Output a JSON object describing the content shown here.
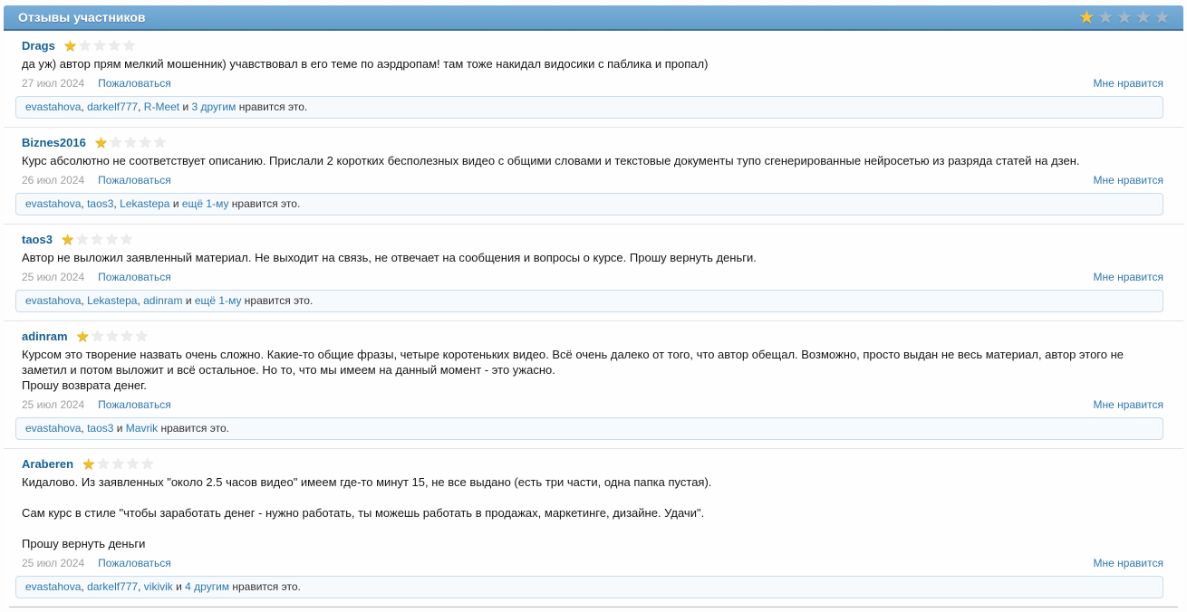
{
  "header": {
    "title": "Отзывы участников",
    "rating": 1,
    "max_rating": 5
  },
  "ui": {
    "report_label": "Пожаловаться",
    "like_label": "Мне нравится"
  },
  "colors": {
    "accent_bar": "#6aa3d0",
    "link": "#2e77ad",
    "username_link": "#176093",
    "star_gold": "#f1bf27",
    "star_empty": "#ececec",
    "like_box_bg": "#f6fafd",
    "like_box_border": "#c9dcea"
  },
  "reviews": [
    {
      "username": "Drags",
      "rating": 1,
      "date": "27 июл 2024",
      "paragraphs": [
        "да уж) автор прям мелкий мошенник) учавствовал в его теме по аэрдропам! там тоже накидал видосики с паблика и пропал)"
      ],
      "likes": [
        {
          "t": "evastahova",
          "link": true
        },
        {
          "t": ", ",
          "link": false
        },
        {
          "t": "darkelf777",
          "link": true
        },
        {
          "t": ", ",
          "link": false
        },
        {
          "t": "R-Meet",
          "link": true
        },
        {
          "t": " и ",
          "link": false
        },
        {
          "t": "3 другим",
          "link": true
        },
        {
          "t": " нравится это.",
          "link": false
        }
      ]
    },
    {
      "username": "Biznes2016",
      "rating": 1,
      "date": "26 июл 2024",
      "paragraphs": [
        "Курс абсолютно не соответствует описанию. Прислали 2 коротких бесполезных видео с общими словами и текстовые документы тупо сгенерированные нейросетью из разряда статей на дзен."
      ],
      "likes": [
        {
          "t": "evastahova",
          "link": true
        },
        {
          "t": ", ",
          "link": false
        },
        {
          "t": "taos3",
          "link": true
        },
        {
          "t": ", ",
          "link": false
        },
        {
          "t": "Lekastepa",
          "link": true
        },
        {
          "t": " и ",
          "link": false
        },
        {
          "t": "ещё 1-му",
          "link": true
        },
        {
          "t": " нравится это.",
          "link": false
        }
      ]
    },
    {
      "username": "taos3",
      "rating": 1,
      "date": "25 июл 2024",
      "paragraphs": [
        "Автор не выложил заявленный материал. Не выходит на связь, не отвечает на сообщения и вопросы о курсе. Прошу вернуть деньги."
      ],
      "likes": [
        {
          "t": "evastahova",
          "link": true
        },
        {
          "t": ", ",
          "link": false
        },
        {
          "t": "Lekastepa",
          "link": true
        },
        {
          "t": ", ",
          "link": false
        },
        {
          "t": "adinram",
          "link": true
        },
        {
          "t": " и ",
          "link": false
        },
        {
          "t": "ещё 1-му",
          "link": true
        },
        {
          "t": " нравится это.",
          "link": false
        }
      ]
    },
    {
      "username": "adinram",
      "rating": 1,
      "date": "25 июл 2024",
      "paragraphs": [
        "Курсом это творение назвать очень сложно. Какие-то общие фразы, четыре коротеньких видео. Всё очень далеко от того, что автор обещал. Возможно, просто выдан не весь материал, автор этого не заметил и потом выложит и всё остальное. Но то, что мы имеем на данный момент - это ужасно.",
        "Прошу возврата денег."
      ],
      "likes": [
        {
          "t": "evastahova",
          "link": true
        },
        {
          "t": ", ",
          "link": false
        },
        {
          "t": "taos3",
          "link": true
        },
        {
          "t": " и ",
          "link": false
        },
        {
          "t": "Mavrik",
          "link": true
        },
        {
          "t": " нравится это.",
          "link": false
        }
      ]
    },
    {
      "username": "Araberen",
      "rating": 1,
      "date": "25 июл 2024",
      "paragraphs": [
        "Кидалово. Из заявленных \"около 2.5 часов видео\" имеем где-то минут 15, не все выдано (есть три части, одна папка пустая).",
        "",
        "Сам курс в стиле \"чтобы заработать денег - нужно работать, ты можешь работать в продажах, маркетинге, дизайне. Удачи\".",
        "",
        "Прошу вернуть деньги"
      ],
      "likes": [
        {
          "t": "evastahova",
          "link": true
        },
        {
          "t": ", ",
          "link": false
        },
        {
          "t": "darkelf777",
          "link": true
        },
        {
          "t": ", ",
          "link": false
        },
        {
          "t": "vikivik",
          "link": true
        },
        {
          "t": " и ",
          "link": false
        },
        {
          "t": "4 другим",
          "link": true
        },
        {
          "t": " нравится это.",
          "link": false
        }
      ]
    }
  ]
}
